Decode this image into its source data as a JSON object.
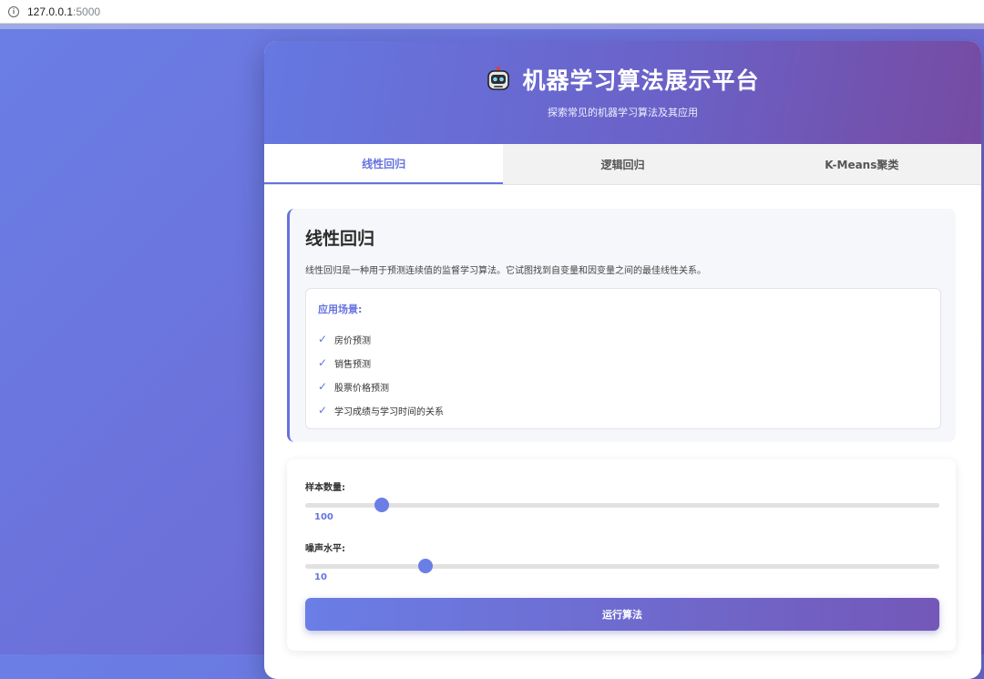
{
  "browser": {
    "host": "127.0.0.1",
    "port": ":5000"
  },
  "header": {
    "title": "机器学习算法展示平台",
    "subtitle": "探索常见的机器学习算法及其应用"
  },
  "tabs": [
    {
      "label": "线性回归",
      "active": true
    },
    {
      "label": "逻辑回归",
      "active": false
    },
    {
      "label": "K-Means聚类",
      "active": false
    }
  ],
  "info": {
    "title": "线性回归",
    "description": "线性回归是一种用于预测连续值的监督学习算法。它试图找到自变量和因变量之间的最佳线性关系。",
    "applications_title": "应用场景:",
    "applications": [
      "房价预测",
      "销售预测",
      "股票价格预测",
      "学习成绩与学习时间的关系"
    ],
    "check_icon": "✓"
  },
  "controls": {
    "samples": {
      "label": "样本数量:",
      "value": "100",
      "fraction": 0.12
    },
    "noise": {
      "label": "噪声水平:",
      "value": "10",
      "fraction": 0.19
    },
    "run_label": "运行算法"
  },
  "colors": {
    "accent": "#6672e0",
    "gradient_start": "#6a7ee6",
    "gradient_end": "#764ba2"
  }
}
